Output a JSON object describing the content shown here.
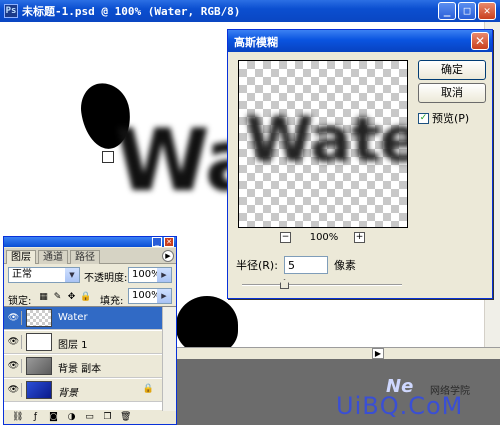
{
  "document": {
    "title": "未标题-1.psd @ 100% (Water, RGB/8)",
    "canvas_text": "Wa"
  },
  "window_controls": {
    "minimize": "_",
    "maximize": "□",
    "close": "✕"
  },
  "dialog": {
    "title": "高斯模糊",
    "preview_text": "Wate",
    "ok_label": "确定",
    "cancel_label": "取消",
    "preview_label": "预览(P)",
    "preview_checked": true,
    "zoom_level": "100%",
    "zoom_out": "−",
    "zoom_in": "+",
    "radius_label": "半径(R):",
    "radius_value": "5",
    "radius_unit": "像素",
    "radius_slider_value": 5
  },
  "layers_panel": {
    "tabs": [
      "图层",
      "通道",
      "路径"
    ],
    "blend_mode": "正常",
    "opacity_label": "不透明度:",
    "opacity_value": "100%",
    "lock_label": "锁定:",
    "fill_label": "填充:",
    "fill_value": "100%",
    "layers": [
      {
        "name": "Water",
        "thumb": "checker",
        "selected": true
      },
      {
        "name": "图层 1",
        "thumb": "mask",
        "selected": false
      },
      {
        "name": "背景 副本",
        "thumb": "gray",
        "selected": false
      },
      {
        "name": "背景",
        "thumb": "blue",
        "selected": false,
        "locked": true
      }
    ]
  },
  "watermark": {
    "text": "UiBQ.CoM",
    "logo": "Ne",
    "cjk": "网络学院"
  },
  "icons": {
    "eye": "eye-icon",
    "lock": "lock-icon",
    "link": "link-icon",
    "effects": "fx-icon",
    "mask": "mask-icon",
    "adjust": "adjustment-icon",
    "group": "folder-icon",
    "new": "new-layer-icon",
    "trash": "trash-icon"
  },
  "colors": {
    "titlebar": "#0a54e0",
    "selection": "#316ac5",
    "dialog_bg": "#ece9d8",
    "watermark": "#3a4fd4"
  }
}
